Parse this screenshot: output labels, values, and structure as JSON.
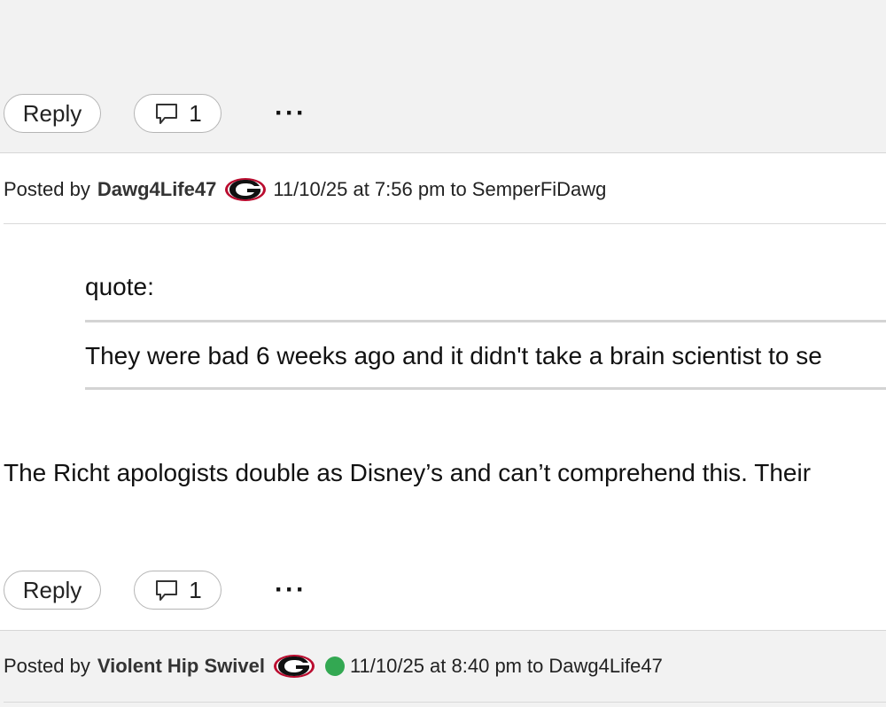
{
  "post_actions": {
    "reply_label": "Reply",
    "reply_count": "1",
    "more_label": "···"
  },
  "post1": {
    "posted_by_label": "Posted by",
    "author": "Dawg4Life47",
    "badge_icon": "georgia-g-logo-icon",
    "timestamp": "11/10/25 at 7:56 pm",
    "to_label": "to",
    "reply_to": "SemperFiDawg",
    "quote_label": "quote:",
    "quote_text": "They were bad 6 weeks ago and it didn't take a brain scientist to se",
    "body_text": "The Richt apologists double as Disney’s and can’t comprehend this. Their"
  },
  "post2": {
    "posted_by_label": "Posted by",
    "author": "Violent Hip Swivel",
    "badge_icon": "georgia-g-logo-icon",
    "online_status_color": "#33a852",
    "timestamp": "11/10/25 at 8:40 pm",
    "to_label": "to",
    "reply_to": "Dawg4Life47"
  },
  "colors": {
    "band_gray": "#f2f2f2",
    "content_white": "#ffffff",
    "logo_red": "#ba0c2f"
  }
}
